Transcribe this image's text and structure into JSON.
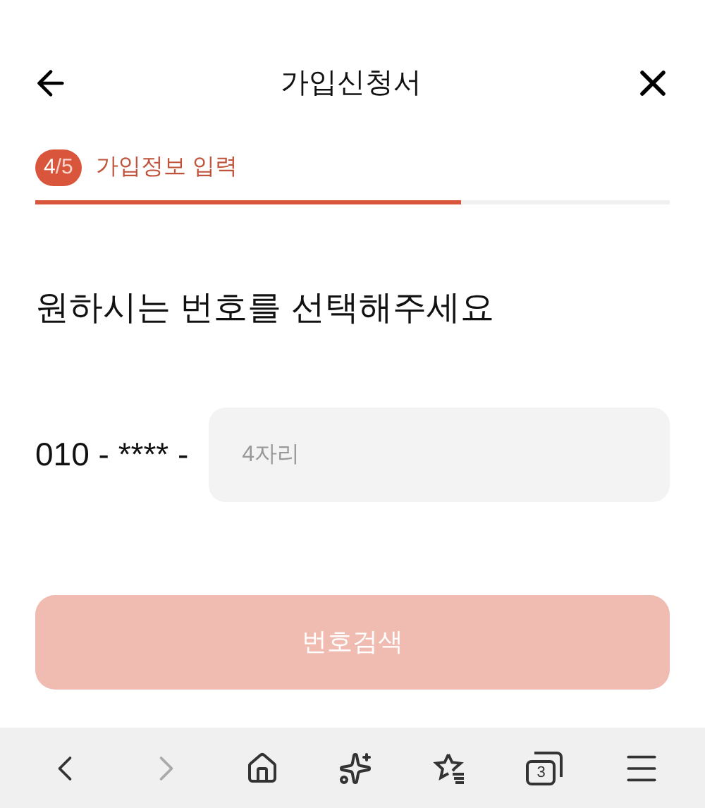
{
  "header": {
    "title": "가입신청서"
  },
  "step": {
    "current": "4",
    "total": "/5",
    "label": "가입정보 입력",
    "level": 0.67
  },
  "heading": "원하시는 번호를 선택해주세요",
  "phone": {
    "prefix": "010 - **** -",
    "placeholder": "4자리"
  },
  "search_button": {
    "label": "번호검색",
    "disabled": true
  },
  "browser_bar": {
    "tab_count": "3",
    "forward_disabled": true
  }
}
